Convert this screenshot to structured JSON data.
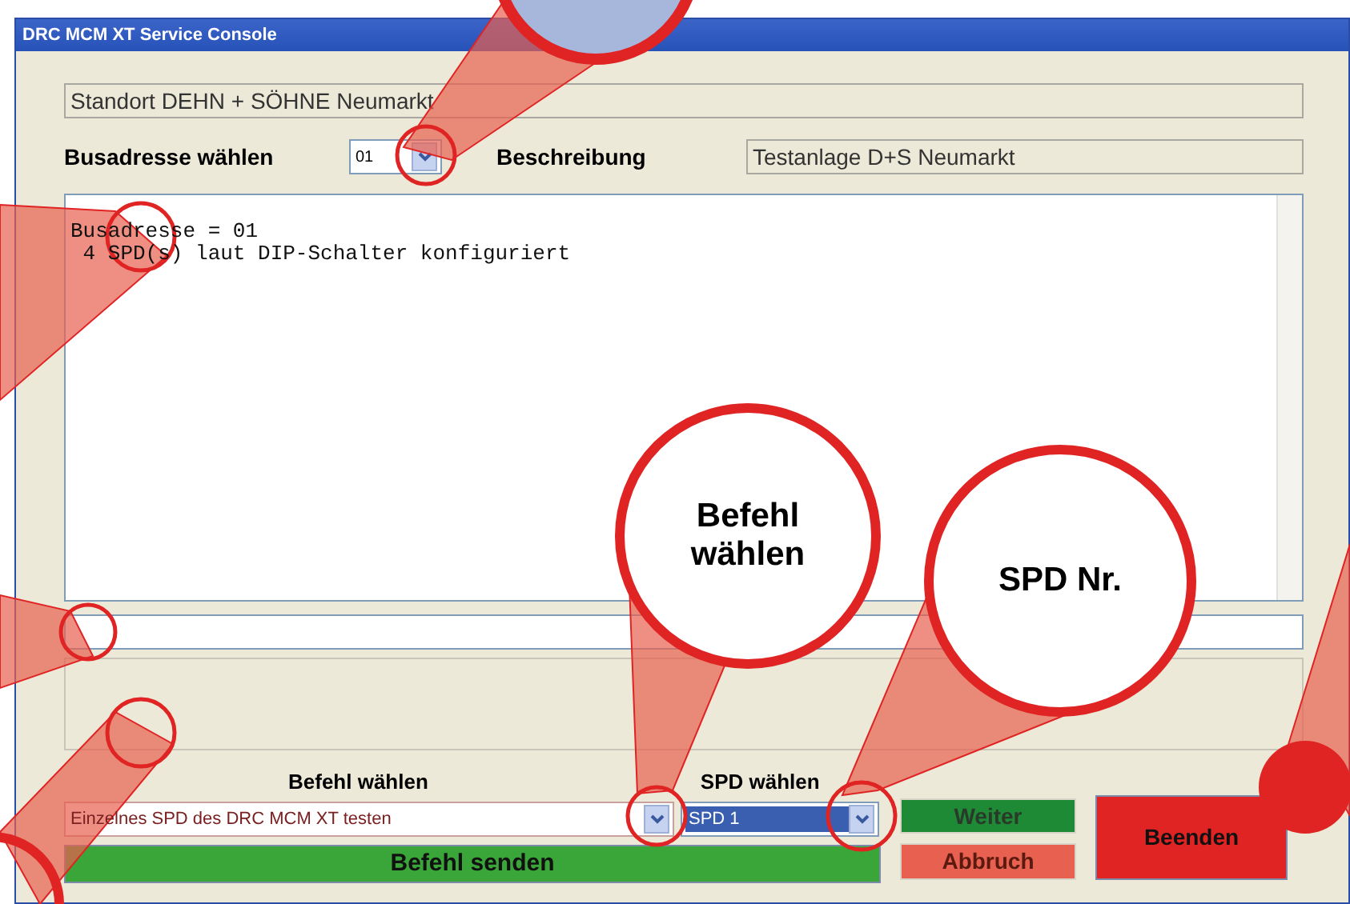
{
  "window": {
    "title": "DRC MCM XT Service Console"
  },
  "location": {
    "value": "Standort DEHN + SÖHNE Neumarkt"
  },
  "bus_address": {
    "label": "Busadresse wählen",
    "value": "01"
  },
  "description": {
    "label": "Beschreibung",
    "value": "Testanlage D+S Neumarkt"
  },
  "log": {
    "lines": [
      "Busadresse = 01",
      " 4 SPD(s) laut DIP-Schalter konfiguriert"
    ]
  },
  "command": {
    "label": "Befehl wählen",
    "value": "Einzelnes SPD des DRC MCM XT testen"
  },
  "spd": {
    "label": "SPD wählen",
    "value": "SPD 1"
  },
  "buttons": [
    {
      "kind": "send",
      "label": "Befehl senden"
    },
    {
      "kind": "next",
      "label": "Weiter"
    },
    {
      "kind": "cancel",
      "label": "Abbruch"
    },
    {
      "kind": "exit",
      "label": "Beenden"
    }
  ],
  "callouts": [
    "Befehl wählen",
    "SPD Nr."
  ]
}
